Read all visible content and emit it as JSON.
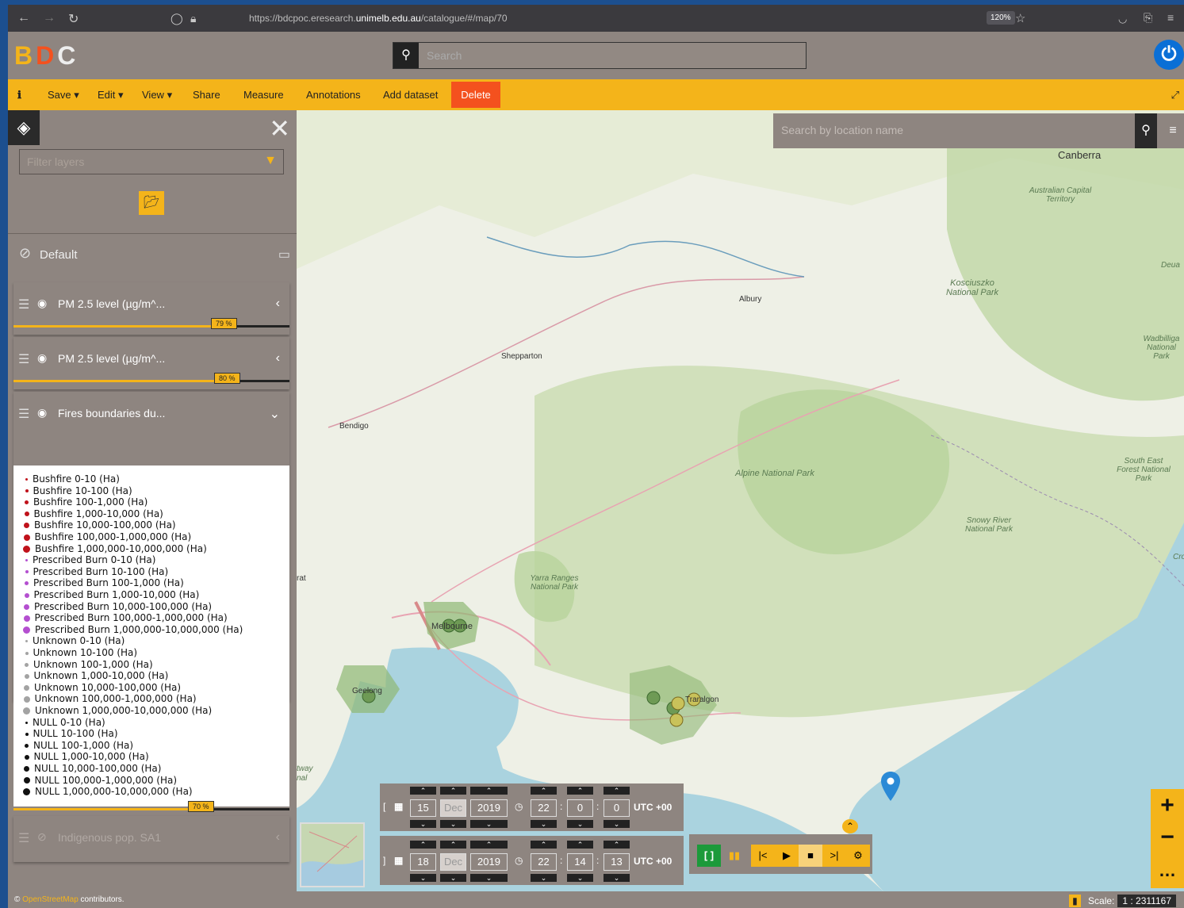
{
  "browser": {
    "back_icon": "back-arrow-icon",
    "url_prefix": "https://bdcpoc.eresearch.",
    "url_host": "unimelb.edu.au",
    "url_path": "/catalogue/#/map/70",
    "zoom": "120%"
  },
  "header": {
    "logo_b": "B",
    "logo_d": "D",
    "logo_c": "C",
    "search_placeholder": "Search",
    "colors": {
      "logo_b": "#f4b41a",
      "logo_d": "#f4511e",
      "logo_c": "#eeeeee",
      "accent": "#f4b41a",
      "delete": "#f4511e"
    }
  },
  "toolbar": {
    "save": "Save",
    "edit": "Edit",
    "view": "View",
    "share": "Share",
    "measure": "Measure",
    "annotations": "Annotations",
    "add_dataset": "Add dataset",
    "delete": "Delete"
  },
  "sidebar": {
    "filter_placeholder": "Filter layers",
    "group_name": "Default",
    "layers": [
      {
        "name": "PM 2.5 level (µg/m^...",
        "opacity": "79 %",
        "opacity_value": 0.79
      },
      {
        "name": "PM 2.5 level (µg/m^...",
        "opacity": "80 %",
        "opacity_value": 0.8
      },
      {
        "name": "Fires boundaries du...",
        "opacity": "70 %",
        "opacity_value": 0.7
      },
      {
        "name": "Indigenous pop. SA1"
      }
    ],
    "legend": [
      {
        "label": "Bushfire 0-10 (Ha)",
        "color": "#c0121b",
        "size": 3
      },
      {
        "label": "Bushfire 10-100 (Ha)",
        "color": "#c0121b",
        "size": 4
      },
      {
        "label": "Bushfire 100-1,000 (Ha)",
        "color": "#c0121b",
        "size": 5
      },
      {
        "label": "Bushfire 1,000-10,000 (Ha)",
        "color": "#c0121b",
        "size": 6
      },
      {
        "label": "Bushfire 10,000-100,000 (Ha)",
        "color": "#c0121b",
        "size": 7
      },
      {
        "label": "Bushfire 100,000-1,000,000 (Ha)",
        "color": "#c0121b",
        "size": 8
      },
      {
        "label": "Bushfire 1,000,000-10,000,000 (Ha)",
        "color": "#c0121b",
        "size": 9
      },
      {
        "label": "Prescribed Burn 0-10 (Ha)",
        "color": "#b44fd0",
        "size": 3
      },
      {
        "label": "Prescribed Burn 10-100 (Ha)",
        "color": "#b44fd0",
        "size": 4
      },
      {
        "label": "Prescribed Burn 100-1,000 (Ha)",
        "color": "#b44fd0",
        "size": 5
      },
      {
        "label": "Prescribed Burn 1,000-10,000 (Ha)",
        "color": "#b44fd0",
        "size": 6
      },
      {
        "label": "Prescribed Burn 10,000-100,000 (Ha)",
        "color": "#b44fd0",
        "size": 7
      },
      {
        "label": "Prescribed Burn 100,000-1,000,000 (Ha)",
        "color": "#b44fd0",
        "size": 8
      },
      {
        "label": "Prescribed Burn 1,000,000-10,000,000 (Ha)",
        "color": "#b44fd0",
        "size": 9
      },
      {
        "label": "Unknown 0-10 (Ha)",
        "color": "#a3a3a3",
        "size": 3
      },
      {
        "label": "Unknown 10-100 (Ha)",
        "color": "#a3a3a3",
        "size": 4
      },
      {
        "label": "Unknown 100-1,000 (Ha)",
        "color": "#a3a3a3",
        "size": 5
      },
      {
        "label": "Unknown 1,000-10,000 (Ha)",
        "color": "#a3a3a3",
        "size": 6
      },
      {
        "label": "Unknown 10,000-100,000 (Ha)",
        "color": "#a3a3a3",
        "size": 7
      },
      {
        "label": "Unknown 100,000-1,000,000 (Ha)",
        "color": "#a3a3a3",
        "size": 8
      },
      {
        "label": "Unknown 1,000,000-10,000,000 (Ha)",
        "color": "#a3a3a3",
        "size": 9
      },
      {
        "label": "NULL 0-10 (Ha)",
        "color": "#111111",
        "size": 3
      },
      {
        "label": "NULL 10-100 (Ha)",
        "color": "#111111",
        "size": 4
      },
      {
        "label": "NULL 100-1,000 (Ha)",
        "color": "#111111",
        "size": 5
      },
      {
        "label": "NULL 1,000-10,000 (Ha)",
        "color": "#111111",
        "size": 6
      },
      {
        "label": "NULL 10,000-100,000 (Ha)",
        "color": "#111111",
        "size": 7
      },
      {
        "label": "NULL 100,000-1,000,000 (Ha)",
        "color": "#111111",
        "size": 8
      },
      {
        "label": "NULL 1,000,000-10,000,000 (Ha)",
        "color": "#111111",
        "size": 9
      }
    ]
  },
  "map": {
    "search_placeholder": "Search by location name",
    "places": {
      "canberra": "Canberra",
      "act": "Australian Capital Territory",
      "kosciuszko": "Kosciuszko National Park",
      "albury": "Albury",
      "shepparton": "Shepparton",
      "bendigo": "Bendigo",
      "alpine": "Alpine National Park",
      "yarra": "Yarra Ranges National Park",
      "melbourne": "Melbourne",
      "snowy": "Snowy River National Park",
      "south_east": "South East Forest National Park",
      "wadbilliga": "Wadbilliga National Park",
      "deua": "Deua",
      "geelong": "Geelong",
      "traralgon": "Traralgon",
      "rat": "rat",
      "tway": "tway",
      "nal": "nal",
      "cro": "Cro"
    }
  },
  "time": {
    "start": {
      "bracket": "[",
      "day": "15",
      "month": "Dec",
      "year": "2019",
      "hour": "22",
      "minute": "0",
      "second": "0",
      "tz": "UTC +00"
    },
    "end": {
      "bracket": "]",
      "day": "18",
      "month": "Dec",
      "year": "2019",
      "hour": "22",
      "minute": "14",
      "second": "13",
      "tz": "UTC +00"
    },
    "colon": ":"
  },
  "footer": {
    "osm": "OpenStreetMap",
    "contributors": "contributors.",
    "scale_label": "Scale:",
    "scale_value": "1 : 2311167"
  }
}
